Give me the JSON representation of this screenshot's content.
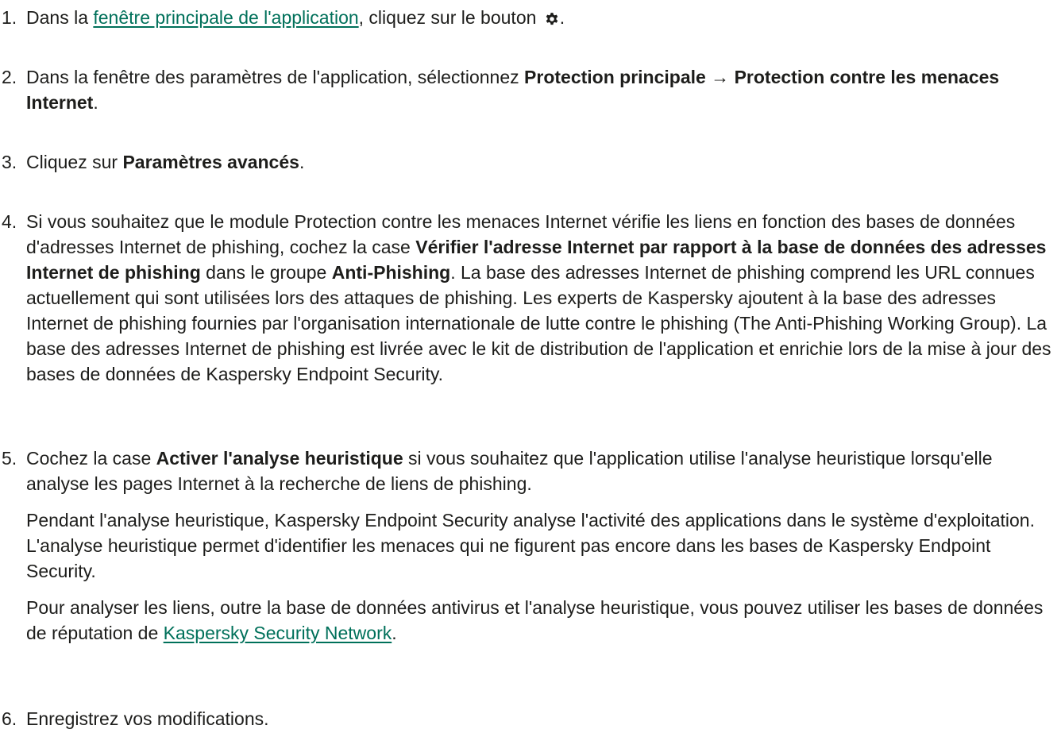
{
  "steps": [
    {
      "number": "1.",
      "t1": "Dans la ",
      "link": "fenêtre principale de l'application",
      "t2": ", cliquez sur le bouton ",
      "icon": "gear-icon",
      "t3": "."
    },
    {
      "number": "2.",
      "t1": "Dans la fenêtre des paramètres de l'application, sélectionnez ",
      "b1": "Protection principale → Protection contre les menaces Internet",
      "t2": "."
    },
    {
      "number": "3.",
      "t1": "Cliquez sur ",
      "b1": "Paramètres avancés",
      "t2": "."
    },
    {
      "number": "4.",
      "t1": "Si vous souhaitez que le module Protection contre les menaces Internet vérifie les liens en fonction des bases de données d'adresses Internet de phishing, cochez la case ",
      "b1": "Vérifier l'adresse Internet par rapport à la base de données des adresses Internet de phishing",
      "t2": " dans le groupe ",
      "b2": "Anti-Phishing",
      "t3": ". La base des adresses Internet de phishing comprend les URL connues actuellement qui sont utilisées lors des attaques de phishing. Les experts de Kaspersky ajoutent à la base des adresses Internet de phishing fournies par l'organisation internationale de lutte contre le phishing (The Anti-Phishing Working Group). La base des adresses Internet de phishing est livrée avec le kit de distribution de l'application et enrichie lors de la mise à jour des bases de données de Kaspersky Endpoint Security."
    },
    {
      "number": "5.",
      "t1": "Cochez la case ",
      "b1": "Activer l'analyse heuristique",
      "t2": " si vous souhaitez que l'application utilise l'analyse heuristique lorsqu'elle analyse les pages Internet à la recherche de liens de phishing.",
      "p2": "Pendant l'analyse heuristique, Kaspersky Endpoint Security analyse l'activité des applications dans le système d'exploitation. L'analyse heuristique permet d'identifier les menaces qui ne figurent pas encore dans les bases de Kaspersky Endpoint Security.",
      "p3_t1": "Pour analyser les liens, outre la base de données antivirus et l'analyse heuristique, vous pouvez utiliser les bases de données de réputation de ",
      "p3_link": "Kaspersky Security Network",
      "p3_t2": "."
    },
    {
      "number": "6.",
      "t1": "Enregistrez vos modifications."
    }
  ],
  "colors": {
    "text": "#1d1d1b",
    "link": "#00705a",
    "background": "#ffffff"
  }
}
